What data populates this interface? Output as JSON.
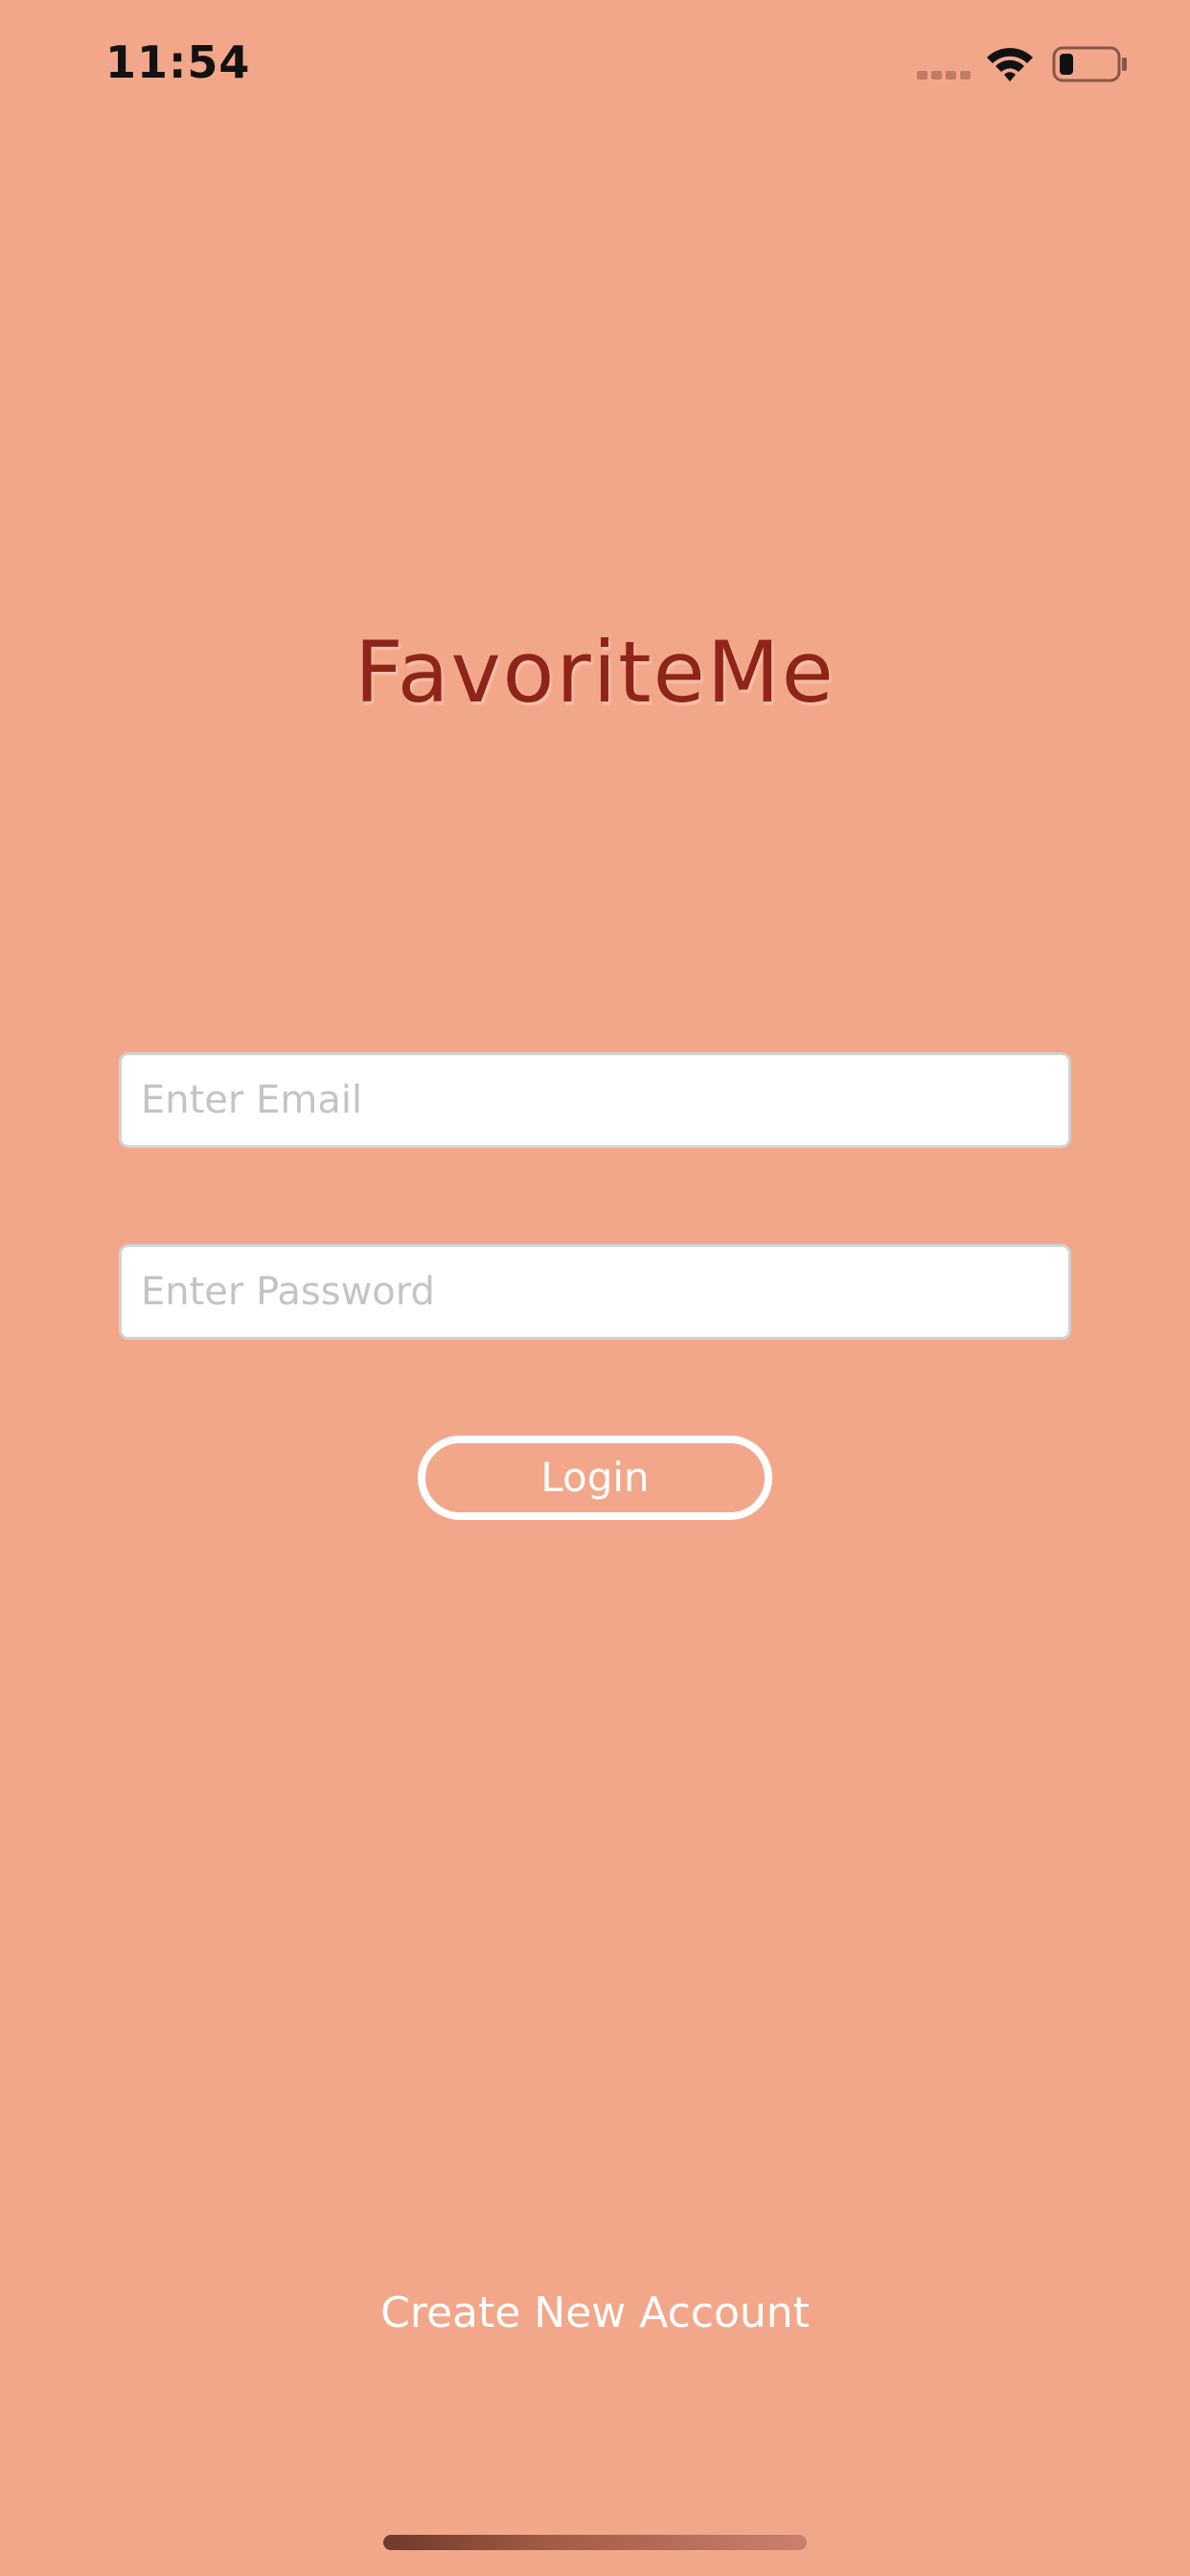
{
  "status_bar": {
    "time": "11:54",
    "icons": [
      "signal-dots-icon",
      "wifi-icon",
      "battery-icon"
    ]
  },
  "app": {
    "title": "FavoriteMe"
  },
  "form": {
    "email_placeholder": "Enter Email",
    "email_value": "",
    "password_placeholder": "Enter Password",
    "password_value": "",
    "login_label": "Login"
  },
  "footer": {
    "create_account_label": "Create New Account"
  },
  "colors": {
    "background": "#F3A78A",
    "title": "#8E2518",
    "button_text": "#FFFFFF"
  }
}
